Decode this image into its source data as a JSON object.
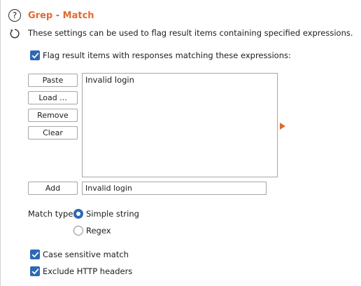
{
  "header": {
    "title": "Grep - Match",
    "help_icon_glyph": "?",
    "description": "These settings can be used to flag result items containing specified expressions."
  },
  "flag_checkbox": {
    "label": "Flag result items with responses matching these expressions:",
    "checked": true
  },
  "buttons": {
    "paste": "Paste",
    "load": "Load ...",
    "remove": "Remove",
    "clear": "Clear",
    "add": "Add"
  },
  "expressions": [
    "Invalid login"
  ],
  "add_input_value": "Invalid login",
  "match_type": {
    "label": "Match type:",
    "options": [
      {
        "label": "Simple string",
        "selected": true
      },
      {
        "label": "Regex",
        "selected": false
      }
    ]
  },
  "options": {
    "case_sensitive": {
      "label": "Case sensitive match",
      "checked": true
    },
    "exclude_headers": {
      "label": "Exclude HTTP headers",
      "checked": true
    }
  },
  "colors": {
    "accent": "#e06b2d",
    "checkbox": "#2c68b7"
  }
}
